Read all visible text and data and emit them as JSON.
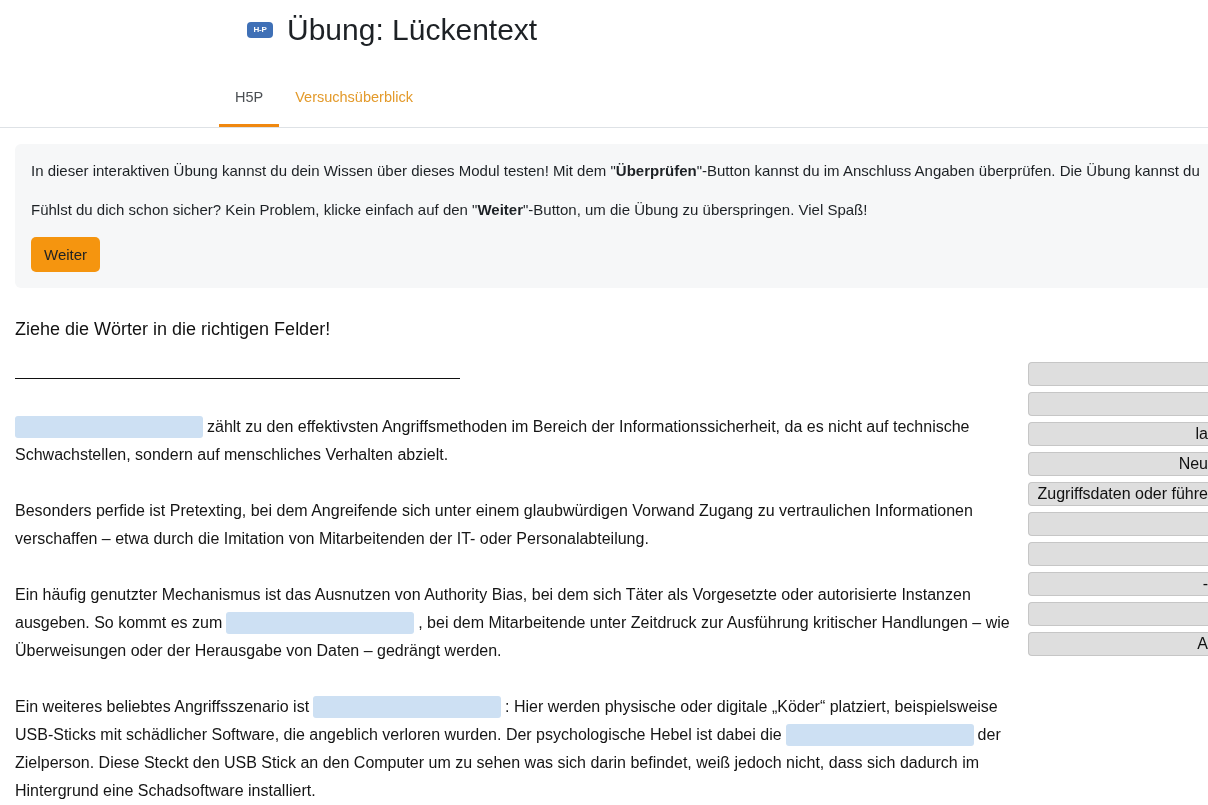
{
  "header": {
    "logo": "H-P",
    "title": "Übung: Lückentext"
  },
  "tabs": [
    {
      "label": "H5P",
      "selected": true
    },
    {
      "label": "Versuchsüberblick",
      "selected": false
    }
  ],
  "intro": {
    "paragraphs": [
      "In dieser interaktiven Übung kannst du dein Wissen über dieses Modul testen! Mit dem \"**Überprüfen**\"-Button kannst du im Anschluss Angaben überprüfen. Die Übung kannst du",
      "Fühlst du dich schon sicher? Kein Problem, klicke einfach auf den \"**Weiter**\"-Button, um die Übung zu überspringen. Viel Spaß!"
    ],
    "button": "Weiter"
  },
  "task": {
    "instruction": "Ziehe die Wörter in die richtigen Felder!",
    "paragraphs": [
      {
        "lines": [
          [
            {
              "kind": "blank"
            },
            {
              "kind": "text",
              "text": "zählt zu den effektivsten Angriffsmethoden im Bereich der Informationssicherheit, da es nicht auf technische"
            }
          ],
          [
            {
              "kind": "text",
              "text": "Schwachstellen, sondern auf menschliches Verhalten abzielt."
            }
          ]
        ]
      },
      {
        "lines": [
          [
            {
              "kind": "text",
              "text": "Besonders perfide ist Pretexting, bei dem Angreifende sich unter einem glaubwürdigen Vorwand Zugang zu vertraulichen Informationen"
            }
          ],
          [
            {
              "kind": "text",
              "text": "verschaffen – etwa durch die Imitation von Mitarbeitenden der IT- oder Personalabteilung."
            }
          ]
        ]
      },
      {
        "lines": [
          [
            {
              "kind": "text",
              "text": "Ein häufig genutzter Mechanismus ist das Ausnutzen von Authority Bias, bei dem sich Täter als Vorgesetzte oder autorisierte Instanzen"
            }
          ],
          [
            {
              "kind": "text",
              "text": "ausgeben. So kommt es zum"
            },
            {
              "kind": "blank"
            },
            {
              "kind": "text",
              "text": ", bei dem Mitarbeitende unter Zeitdruck zur Ausführung kritischer Handlungen – wie"
            }
          ],
          [
            {
              "kind": "text",
              "text": "Überweisungen oder der Herausgabe von Daten – gedrängt werden."
            }
          ]
        ]
      },
      {
        "lines": [
          [
            {
              "kind": "text",
              "text": "Ein weiteres beliebtes Angriffsszenario ist"
            },
            {
              "kind": "blank"
            },
            {
              "kind": "text",
              "text": ": Hier werden physische oder digitale „Köder“ platziert, beispielsweise"
            }
          ],
          [
            {
              "kind": "text",
              "text": "USB-Sticks mit schädlicher Software, die angeblich verloren wurden. Der psychologische Hebel ist dabei die"
            },
            {
              "kind": "blank"
            },
            {
              "kind": "text",
              "text": "der"
            }
          ],
          [
            {
              "kind": "text",
              "text": "Zielperson. Diese Steckt den USB Stick an den Computer um zu sehen was sich darin befindet, weiß jedoch nicht, dass sich dadurch im"
            }
          ],
          [
            {
              "kind": "text",
              "text": "Hintergrund eine Schadsoftware installiert."
            }
          ]
        ]
      }
    ],
    "words": [
      {
        "kind": "plain"
      },
      {
        "kind": "plain"
      },
      {
        "kind": "word",
        "label": "la"
      },
      {
        "kind": "word",
        "label": "Neu"
      },
      {
        "kind": "word",
        "label": "Zugriffsdaten oder führe"
      },
      {
        "kind": "plain"
      },
      {
        "kind": "plain"
      },
      {
        "kind": "word",
        "label": "-"
      },
      {
        "kind": "plain"
      },
      {
        "kind": "word",
        "label": "A"
      }
    ]
  }
}
